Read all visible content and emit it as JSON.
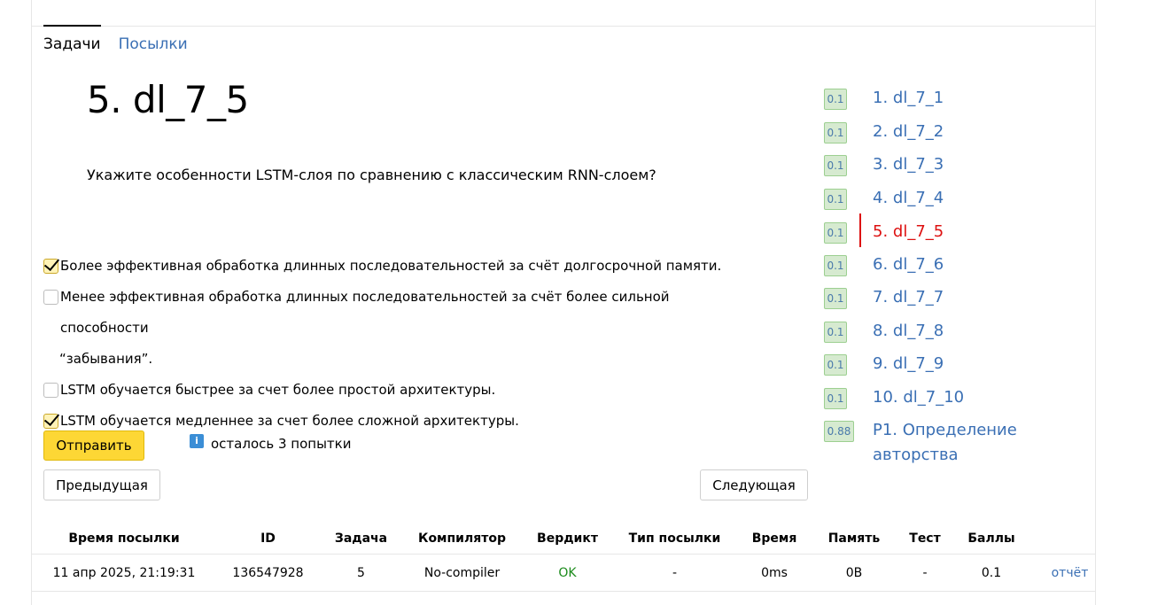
{
  "tabs": [
    {
      "label": "Задачи"
    },
    {
      "label": "Посылки"
    }
  ],
  "problem": {
    "title": "5. dl_7_5",
    "question": "Укажите особенности LSTM-слоя по сравнению с классическим RNN-слоем?"
  },
  "options": [
    {
      "line1": "Более эффективная обработка длинных последовательностей за счёт долгосрочной памяти.",
      "line2": "",
      "checked": true
    },
    {
      "line1": "Менее эффективная обработка длинных последовательностей за счёт более сильной способности",
      "line2": "“забывания”.",
      "checked": false
    },
    {
      "line1": "LSTM обучается быстрее за счет более простой архитектуры.",
      "line2": "",
      "checked": false
    },
    {
      "line1": "LSTM обучается медленнее за счет более сложной архитектуры.",
      "line2": "",
      "checked": true
    }
  ],
  "actions": {
    "submit": "Отправить",
    "attempts": "осталось 3 попытки",
    "info_icon": "i",
    "prev": "Предыдущая",
    "next": "Следующая"
  },
  "problems": [
    {
      "score": "0.1",
      "label": "1. dl_7_1"
    },
    {
      "score": "0.1",
      "label": "2. dl_7_2"
    },
    {
      "score": "0.1",
      "label": "3. dl_7_3"
    },
    {
      "score": "0.1",
      "label": "4. dl_7_4"
    },
    {
      "score": "0.1",
      "label": "5. dl_7_5",
      "current": true
    },
    {
      "score": "0.1",
      "label": "6. dl_7_6"
    },
    {
      "score": "0.1",
      "label": "7. dl_7_7"
    },
    {
      "score": "0.1",
      "label": "8. dl_7_8"
    },
    {
      "score": "0.1",
      "label": "9. dl_7_9"
    },
    {
      "score": "0.1",
      "label": "10. dl_7_10"
    },
    {
      "score": "0.88",
      "label_line1": "P1. Определение",
      "label_line2": "авторства"
    }
  ],
  "submissions": {
    "headers": [
      "Время посылки",
      "ID",
      "Задача",
      "Компилятор",
      "Вердикт",
      "Тип посылки",
      "Время",
      "Память",
      "Тест",
      "Баллы"
    ],
    "rows": [
      {
        "time": "11 апр 2025, 21:19:31",
        "id": "136547928",
        "task": "5",
        "compiler": "No-compiler",
        "verdict": "OK",
        "type": "-",
        "runtime": "0ms",
        "memory": "0B",
        "test": "-",
        "points": "0.1",
        "report": "отчёт"
      }
    ]
  },
  "colors": {
    "accent": "#3a6fb4",
    "current": "#dd1111",
    "submit": "#fdd735",
    "ok": "#1a8a1a"
  }
}
